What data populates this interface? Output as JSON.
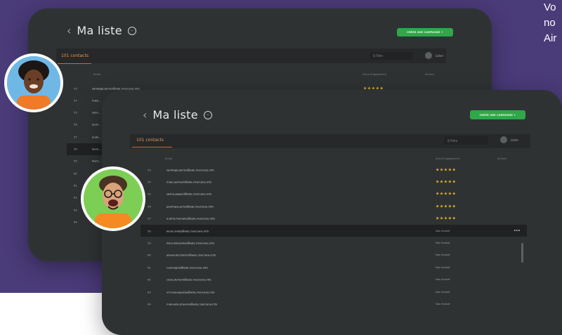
{
  "side_text": [
    "Vo",
    "no",
    "Air"
  ],
  "list_title": "Ma liste",
  "cta_label": "CRÉER UNE CAMPAGNE +",
  "tab_contacts": "101 contacts",
  "search_placeholder": "Q Filtre",
  "filter_label": "Lister",
  "columns": {
    "email": "Email",
    "score": "Score Engagement",
    "actions": "Actions"
  },
  "back_rows": [
    {
      "num": "53",
      "email": "santiago.perrez@ade.rivercane.info",
      "rating": 5
    },
    {
      "num": "54",
      "email": "maxi...",
      "rating": null
    },
    {
      "num": "55",
      "email": "selin...",
      "rating": null
    },
    {
      "num": "56",
      "email": "pauli...",
      "rating": null
    },
    {
      "num": "57",
      "email": "aude...",
      "rating": null
    },
    {
      "num": "58",
      "email": "leelu...",
      "rating": null
    },
    {
      "num": "59",
      "email": "iliani...",
      "rating": null
    },
    {
      "num": "60",
      "email": "alexa...",
      "rating": null
    },
    {
      "num": "61",
      "email": "...",
      "rating": null
    },
    {
      "num": "62",
      "email": "...",
      "rating": null
    },
    {
      "num": "63",
      "email": "...",
      "rating": null
    },
    {
      "num": "64",
      "email": "...",
      "rating": null
    }
  ],
  "front_rows": [
    {
      "num": "53",
      "email": "santiago.perrez@ade.rivercane.info",
      "rating": 5,
      "status": ""
    },
    {
      "num": "54",
      "email": "maxi.jesment@ade.rivercane.info",
      "rating": 5,
      "status": ""
    },
    {
      "num": "55",
      "email": "selina.gogard@ade.rivercane.info",
      "rating": 5,
      "status": ""
    },
    {
      "num": "56",
      "email": "paulhque.jume@ade.rivercane.info",
      "rating": 5,
      "status": ""
    },
    {
      "num": "57",
      "email": "audrie.fresnaies@ade.rivercane.info",
      "rating": 5,
      "status": ""
    },
    {
      "num": "58",
      "email": "leeliu.lindig@ade.rivercane.info",
      "rating": null,
      "status": "Non évalué"
    },
    {
      "num": "59",
      "email": "iliani.delvaintes@ade.rivercane.info",
      "rating": null,
      "status": "Non évalué"
    },
    {
      "num": "60",
      "email": "alexandre.bierlin@ade.rivercane.info",
      "rating": null,
      "status": "Non évalué"
    },
    {
      "num": "61",
      "email": "ruizmagrid@ade.rivercane.info",
      "rating": null,
      "status": "Non évalué"
    },
    {
      "num": "62",
      "email": "clara.dumont@ade.rivercane.info",
      "rating": null,
      "status": "Non évalué"
    },
    {
      "num": "63",
      "email": "vm.larquegurpa@ade.rivercane.info",
      "rating": null,
      "status": "Non évalué"
    },
    {
      "num": "64",
      "email": "manuella.dravons@ade.rivercane.info",
      "rating": null,
      "status": "Non évalué"
    }
  ],
  "more_glyph": "•••",
  "stars_glyph": "★★★★★",
  "colors": {
    "accent": "#2ea84a",
    "star": "#e5b52f",
    "tab": "#e29a5a",
    "bg_purple": "#4a3b79",
    "panel": "#2f3233"
  }
}
